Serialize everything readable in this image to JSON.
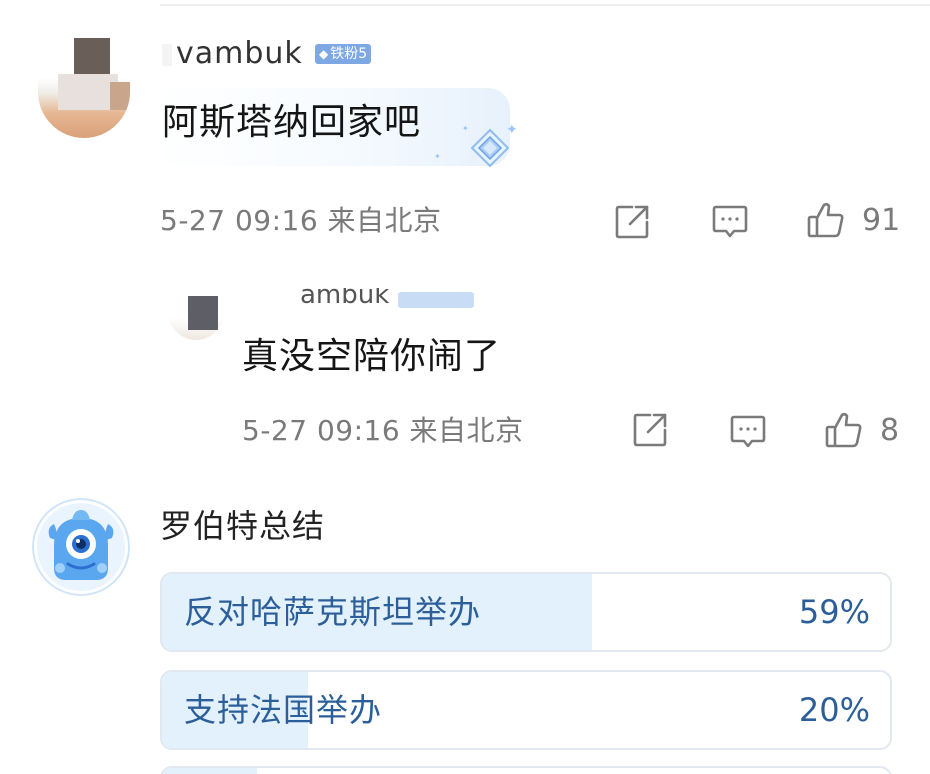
{
  "comments": [
    {
      "username": "vambuk",
      "fan_badge": "铁粉5",
      "text": "阿斯塔纳回家吧",
      "time": "5-27 09:16",
      "location": "来自北京",
      "likes": "91"
    },
    {
      "username": "ambuk",
      "fan_badge": "",
      "text": "真没空陪你闹了",
      "time": "5-27 09:16",
      "location": "来自北京",
      "likes": "8"
    }
  ],
  "poll": {
    "title": "罗伯特总结",
    "options": [
      {
        "label": "反对哈萨克斯坦举办",
        "percent": "59%",
        "fraction": 0.59
      },
      {
        "label": "支持法国举办",
        "percent": "20%",
        "fraction": 0.2
      },
      {
        "label": "",
        "percent": "",
        "fraction": 0.13
      }
    ]
  },
  "icons": {
    "share": "share-icon",
    "comment": "comment-icon",
    "like": "thumbs-up-icon",
    "badge": "diamond-icon"
  },
  "colors": {
    "accent": "#2c5f99",
    "poll_fill": "#e3f1fd",
    "meta_text": "#7a7a7a",
    "badge": "#7ea8e3"
  }
}
